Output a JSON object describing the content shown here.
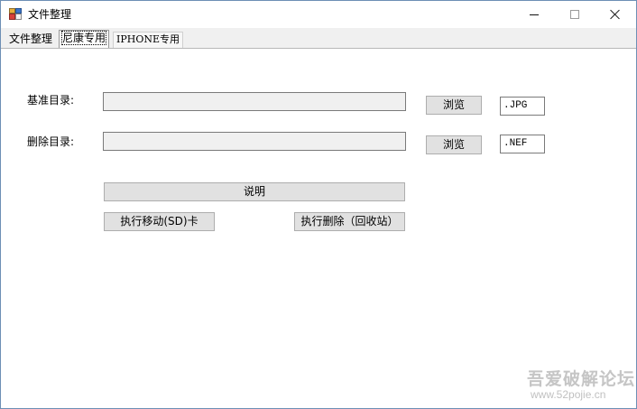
{
  "window": {
    "title": "文件整理",
    "icon": "app-form-icon"
  },
  "tabs": [
    {
      "label": "文件整理",
      "selected": false
    },
    {
      "label": "尼康专用",
      "selected": true
    },
    {
      "label": "IPHONE专用",
      "selected": false
    }
  ],
  "form": {
    "base_dir_label": "基准目录:",
    "base_dir_value": "",
    "delete_dir_label": "删除目录:",
    "delete_dir_value": "",
    "browse_label_1": "浏览",
    "browse_label_2": "浏览",
    "ext_1": ".JPG",
    "ext_2": ".NEF",
    "help_label": "说明",
    "move_label": "执行移动(SD)卡",
    "delete_label": "执行删除（回收站）"
  },
  "watermark": {
    "text": "吾爱破解论坛",
    "url": "www.52pojie.cn"
  }
}
